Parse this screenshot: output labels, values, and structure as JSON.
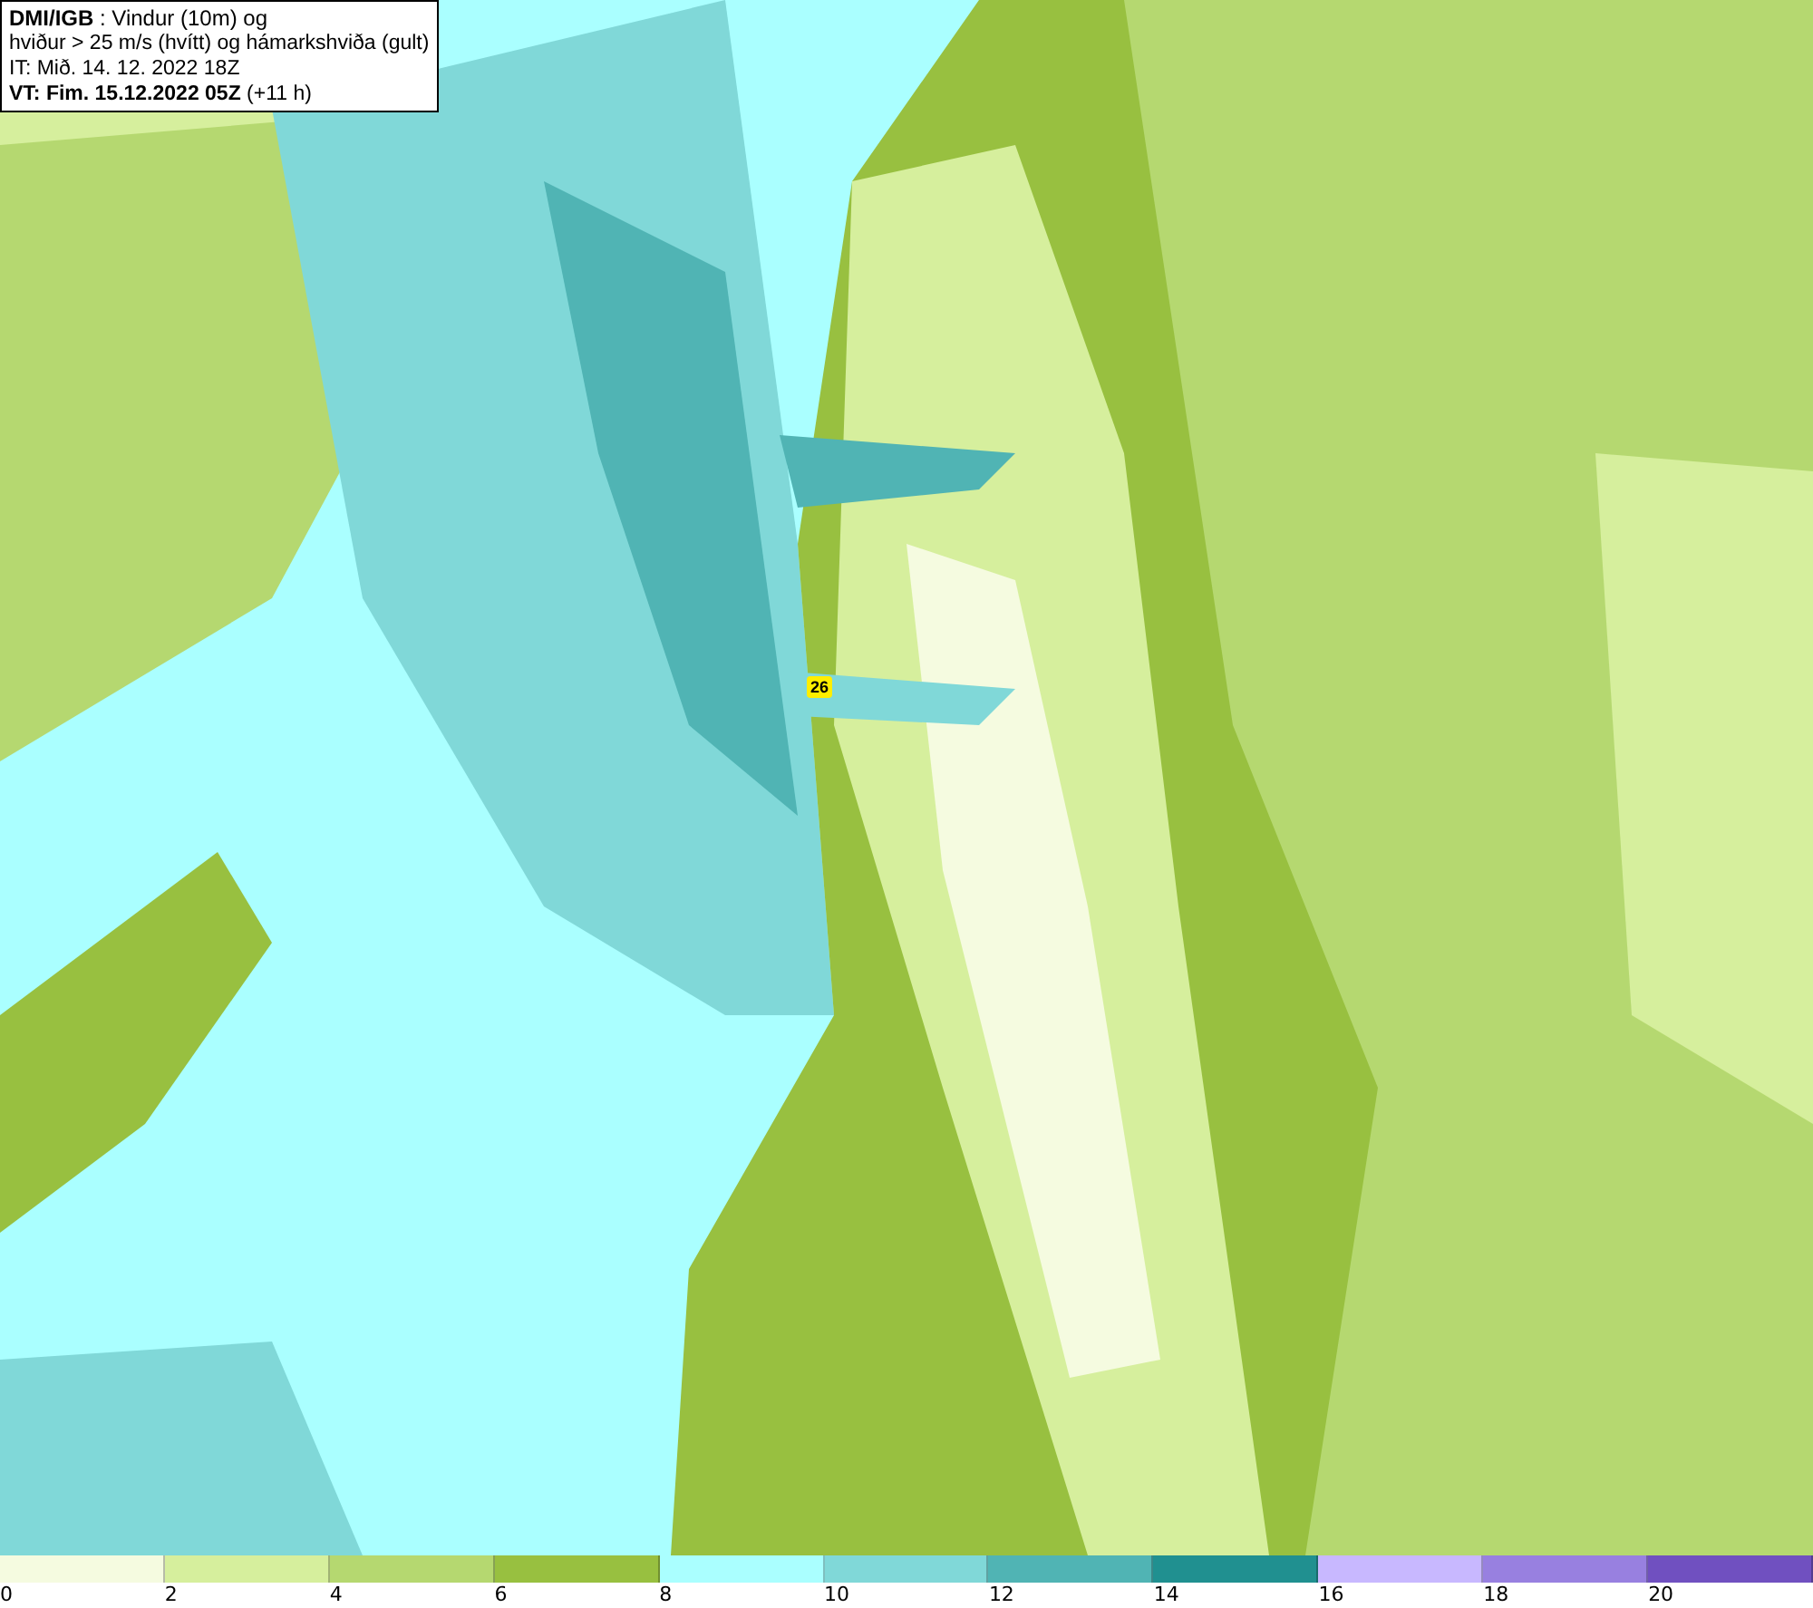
{
  "info_box": {
    "lines": [
      "**DMI/IGB** : Vindur (10m) og",
      "hviður > 25 m/s (hvítt) og hámarkshviða (gult)",
      "IT: Mið. 14. 12. 2022 18Z",
      "**VT: Fim. 15.12.2022 05Z** (+11 h)"
    ]
  },
  "map": {
    "max_gust_label": "26"
  },
  "legend": {
    "bins": [
      {
        "color": "#f5fbe0"
      },
      {
        "color": "#d6ef9d"
      },
      {
        "color": "#b5d870"
      },
      {
        "color": "#98c040"
      },
      {
        "color": "#aaffff"
      },
      {
        "color": "#80d8d8"
      },
      {
        "color": "#50b4b4"
      },
      {
        "color": "#209090"
      },
      {
        "color": "#c8b8ff"
      },
      {
        "color": "#9880e0"
      },
      {
        "color": "#7050c0"
      }
    ],
    "ticks": [
      "0",
      "2",
      "4",
      "6",
      "8",
      "10",
      "12",
      "14",
      "16",
      "18",
      "20"
    ]
  }
}
